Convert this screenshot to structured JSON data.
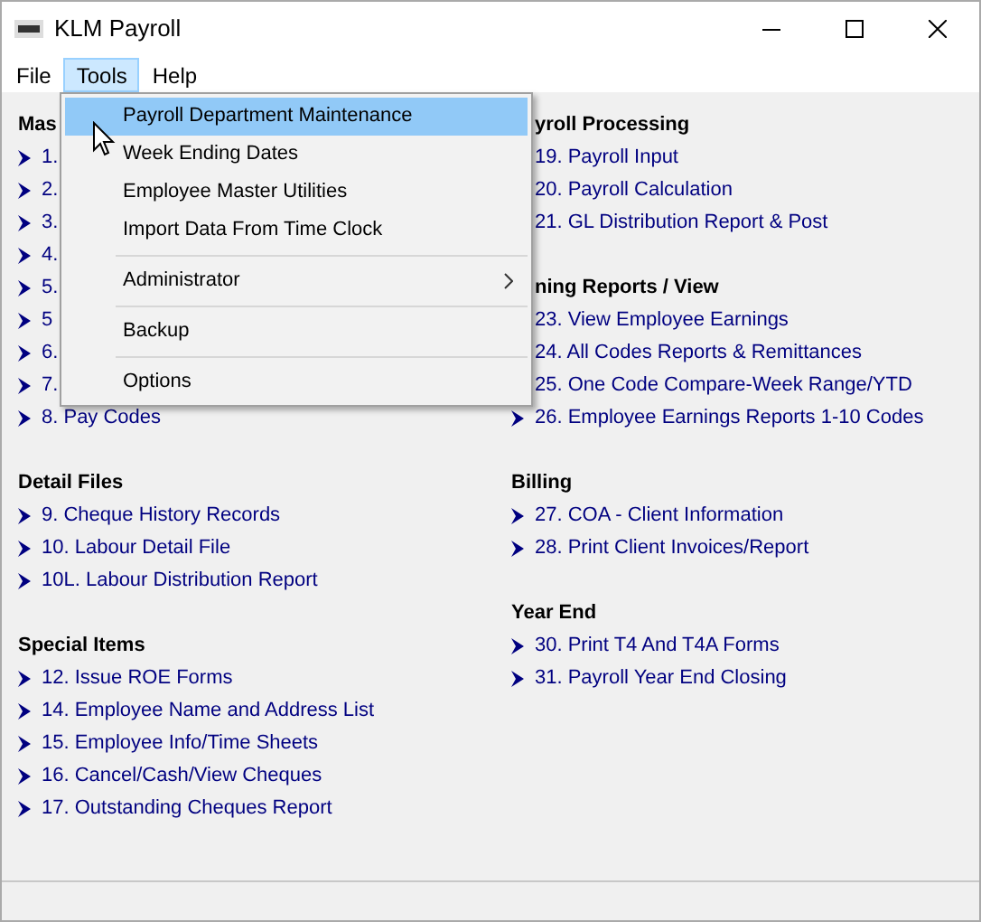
{
  "window": {
    "title": "KLM Payroll"
  },
  "menu_bar": [
    {
      "label": "File",
      "selected": false
    },
    {
      "label": "Tools",
      "selected": true
    },
    {
      "label": "Help",
      "selected": false
    }
  ],
  "dropdown": {
    "items": [
      {
        "kind": "item",
        "label": "Payroll Department Maintenance",
        "selected": true,
        "submenu": false
      },
      {
        "kind": "item",
        "label": "Week Ending Dates",
        "selected": false,
        "submenu": false
      },
      {
        "kind": "item",
        "label": "Employee Master Utilities",
        "selected": false,
        "submenu": false
      },
      {
        "kind": "item",
        "label": "Import Data From Time Clock",
        "selected": false,
        "submenu": false
      },
      {
        "kind": "separator"
      },
      {
        "kind": "item",
        "label": "Administrator",
        "selected": false,
        "submenu": true
      },
      {
        "kind": "separator"
      },
      {
        "kind": "item",
        "label": "Backup",
        "selected": false,
        "submenu": false
      },
      {
        "kind": "separator"
      },
      {
        "kind": "item",
        "label": "Options",
        "selected": false,
        "submenu": false
      }
    ]
  },
  "columns": [
    {
      "sections": [
        {
          "title": "Mas",
          "items": [
            {
              "label": "1.",
              "arrow": true
            },
            {
              "label": "2.",
              "arrow": true
            },
            {
              "label": "3.",
              "arrow": true
            },
            {
              "label": "4.",
              "arrow": true
            },
            {
              "label": "5.",
              "arrow": true
            },
            {
              "label": "5",
              "arrow": true
            },
            {
              "label": "6.",
              "arrow": true
            },
            {
              "label": "7.",
              "arrow": true
            },
            {
              "label": "8. Pay Codes",
              "arrow": true
            }
          ]
        },
        {
          "title": "Detail Files",
          "items": [
            {
              "label": "9. Cheque History Records",
              "arrow": true
            },
            {
              "label": "10. Labour Detail File",
              "arrow": true
            },
            {
              "label": "10L. Labour Distribution Report",
              "arrow": true
            }
          ]
        },
        {
          "title": "Special Items",
          "items": [
            {
              "label": "12. Issue ROE Forms",
              "arrow": true
            },
            {
              "label": "14. Employee Name and Address List",
              "arrow": true
            },
            {
              "label": "15. Employee Info/Time Sheets",
              "arrow": true
            },
            {
              "label": "16. Cancel/Cash/View Cheques",
              "arrow": true
            },
            {
              "label": "17. Outstanding Cheques Report",
              "arrow": true
            }
          ]
        }
      ]
    },
    {
      "sections": [
        {
          "title": "yroll Processing",
          "items": [
            {
              "label": "19. Payroll Input",
              "arrow": false
            },
            {
              "label": "20. Payroll Calculation",
              "arrow": false
            },
            {
              "label": "21. GL Distribution Report & Post",
              "arrow": false
            }
          ]
        },
        {
          "title": "ning Reports / View",
          "items": [
            {
              "label": "23. View Employee Earnings",
              "arrow": false
            },
            {
              "label": "24. All Codes Reports & Remittances",
              "arrow": false
            },
            {
              "label": "25. One Code Compare-Week Range/YTD",
              "arrow": false
            },
            {
              "label": "26. Employee Earnings Reports 1-10 Codes",
              "arrow": true
            }
          ]
        },
        {
          "title": "Billing",
          "items": [
            {
              "label": "27. COA - Client Information",
              "arrow": true
            },
            {
              "label": "28. Print Client Invoices/Report",
              "arrow": true
            }
          ]
        },
        {
          "title": "Year End",
          "items": [
            {
              "label": "30. Print T4 And T4A Forms",
              "arrow": true
            },
            {
              "label": "31. Payroll Year End Closing",
              "arrow": true
            }
          ]
        }
      ]
    }
  ]
}
